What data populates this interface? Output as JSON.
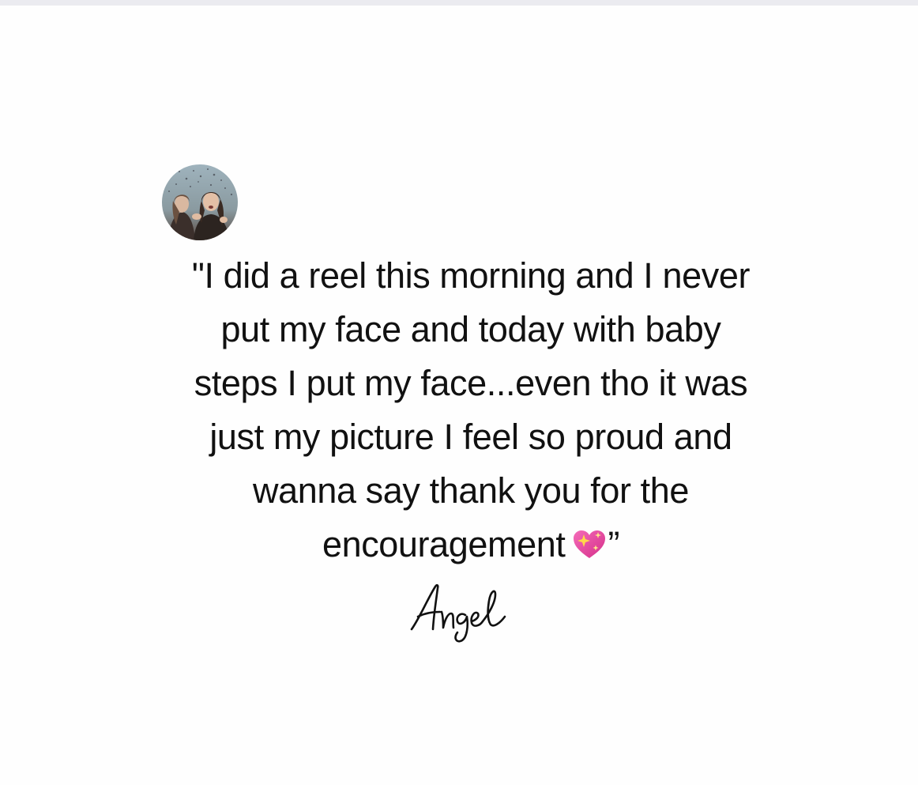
{
  "testimonial": {
    "quote": "\"I did a reel this morning and I never\nput my face and today with baby\nsteps I put my face...even tho it was\njust my picture I feel so proud and\nwanna say thank you for the\nencouragement",
    "closing_mark": "”",
    "emoji_icon": "sparkling-heart-icon",
    "signature": "Angel"
  },
  "colors": {
    "text": "#111111",
    "background": "#fefefe",
    "top_bar": "#ebebf0",
    "heart": "#e83e9c"
  }
}
